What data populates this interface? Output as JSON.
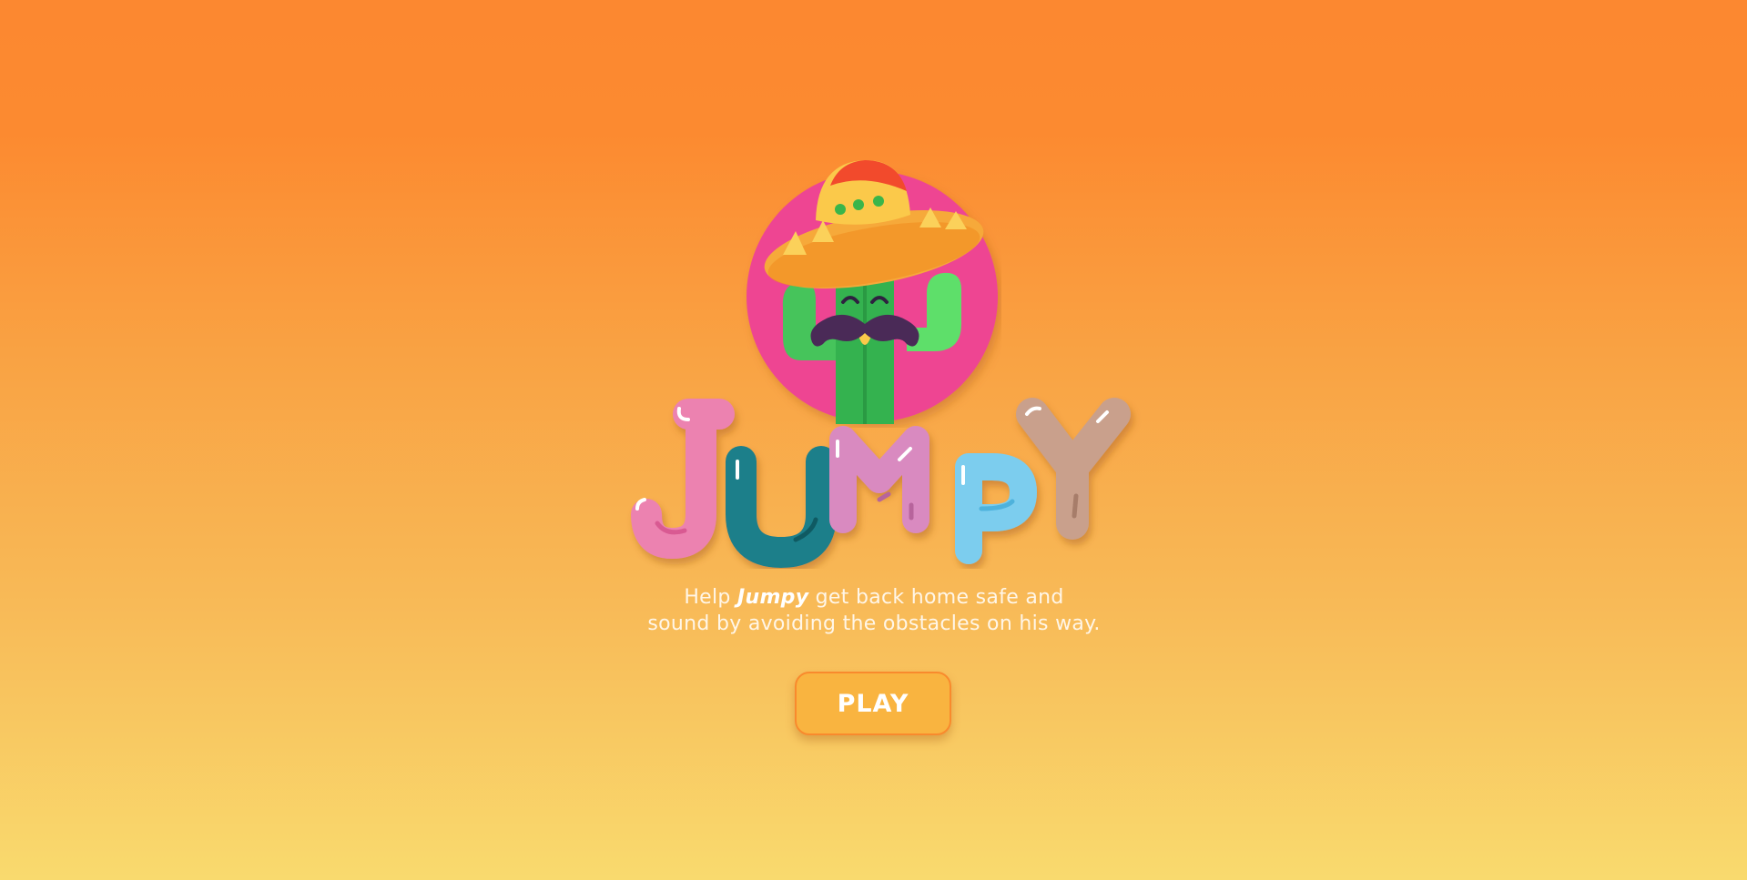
{
  "game": {
    "title_letters": [
      "J",
      "U",
      "M",
      "P",
      "Y"
    ],
    "character_name": "Jumpy",
    "tagline": {
      "before": "Help ",
      "name": "Jumpy",
      "line1_after": " get back home safe and",
      "line2": "sound by avoiding the obstacles on his way."
    },
    "play_label": "PLAY"
  },
  "icons": {
    "logo": "cactus-sombrero-mustache-icon"
  },
  "colors": {
    "background_top": "#fc8830",
    "background_bottom": "#f9da6e",
    "logo_circle": "#ee4592",
    "letter_j": "#ec82b0",
    "letter_u": "#1d7f8a",
    "letter_m": "#d98ac0",
    "letter_p": "#7ccdee",
    "letter_y": "#c9a08c",
    "play_button": "#f9b440"
  }
}
